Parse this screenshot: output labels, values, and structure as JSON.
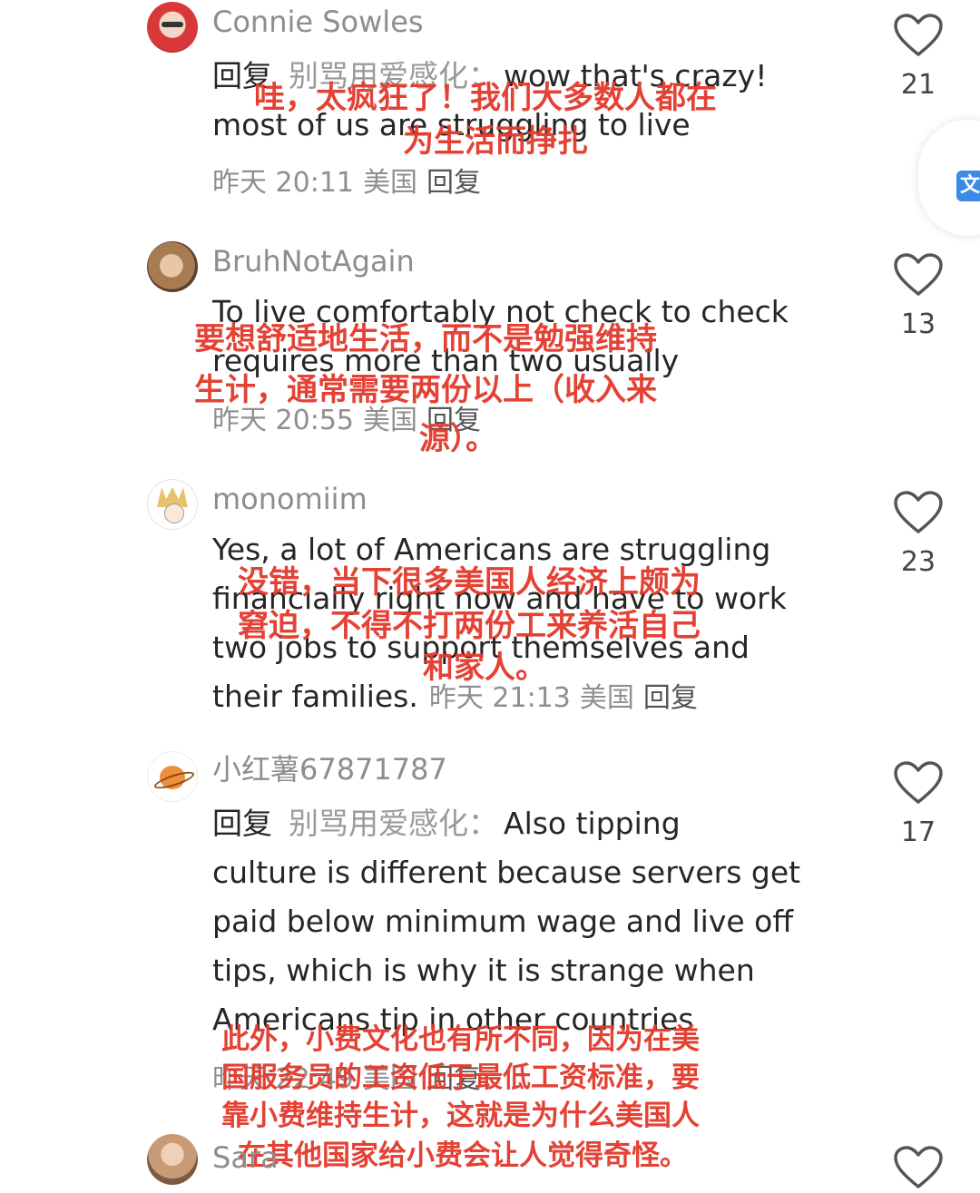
{
  "comments": [
    {
      "username": "Connie Sowles",
      "reply_prefix": "回复",
      "reply_target": "别骂用爱感化：",
      "lines": [
        "wow that's crazy!",
        "most of us are struggling to live"
      ],
      "meta": {
        "time": "昨天 20:11",
        "location": "美国",
        "reply": "回复"
      },
      "likes": "21",
      "translation": [
        "哇，太疯狂了！我们大多数人都在",
        "为生活而挣扎"
      ]
    },
    {
      "username": "BruhNotAgain",
      "lines": [
        "To live comfortably not check to check",
        "requires more than two usually"
      ],
      "meta": {
        "time": "昨天 20:55",
        "location": "美国",
        "reply": "回复"
      },
      "likes": "13",
      "translation": [
        "要想舒适地生活，而不是勉强维持",
        "生计，通常需要两份以上（收入来",
        "源）。"
      ]
    },
    {
      "username": "monomiim",
      "lines": [
        "Yes, a lot of Americans are struggling",
        "financially right now and have to work",
        "two jobs to support themselves and",
        "their families."
      ],
      "meta": {
        "time": "昨天 21:13",
        "location": "美国",
        "reply": "回复"
      },
      "likes": "23",
      "translation": [
        "没错，当下很多美国人经济上颇为",
        "窘迫，不得不打两份工来养活自己",
        "和家人。"
      ]
    },
    {
      "username": "小红薯67871787",
      "reply_prefix": "回复",
      "reply_target": "别骂用爱感化：",
      "lines": [
        "Also tipping",
        "culture is different because servers get",
        "paid below minimum wage and live off",
        "tips, which is why it is strange when",
        "Americans tip in other countries"
      ],
      "meta": {
        "time": "昨天 22:49",
        "location": "美国",
        "reply": "回复"
      },
      "likes": "17",
      "translation": [
        "此外，小费文化也有所不同，因为在美",
        "国服务员的工资低于最低工资标准，要",
        "靠小费维持生计，这就是为什么美国人",
        "在其他国家给小费会让人觉得奇怪。"
      ]
    },
    {
      "username": "Sara"
    }
  ],
  "floating_button": {
    "icon": "translate-icon",
    "glyph": "文"
  },
  "colors": {
    "translation": "#e23b2d",
    "meta": "#8f8f8f",
    "username": "#8d8d8d",
    "text": "#262626"
  }
}
